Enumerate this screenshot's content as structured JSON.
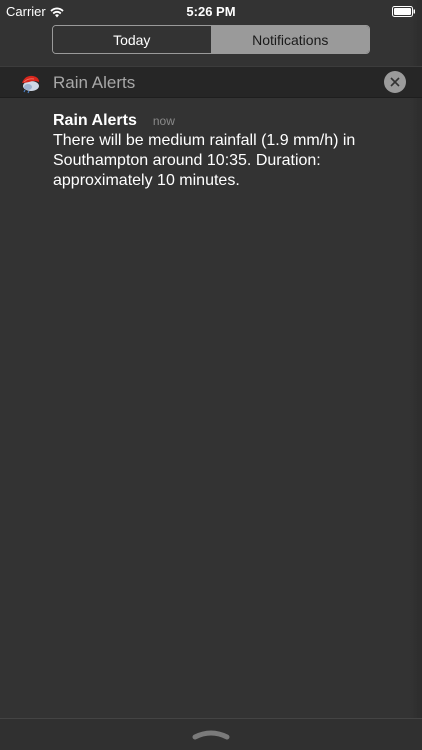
{
  "status_bar": {
    "carrier": "Carrier",
    "time": "5:26 PM",
    "wifi_icon": "wifi-icon",
    "battery_icon": "battery-icon"
  },
  "tabs": [
    {
      "label": "Today",
      "selected": false
    },
    {
      "label": "Notifications",
      "selected": true
    }
  ],
  "section": {
    "title": "Rain Alerts",
    "icon": "rain-alerts-app-icon",
    "clear_icon": "close-icon"
  },
  "notification": {
    "title": "Rain Alerts",
    "time": "now",
    "body": "There will be medium rainfall (1.9 mm/h) in Southampton around 10:35. Duration: approximately 10 minutes."
  },
  "colors": {
    "background": "#333333",
    "header_bar": "#262626",
    "selected_segment": "#9a9a9a",
    "muted_text": "#a8a8a8"
  }
}
